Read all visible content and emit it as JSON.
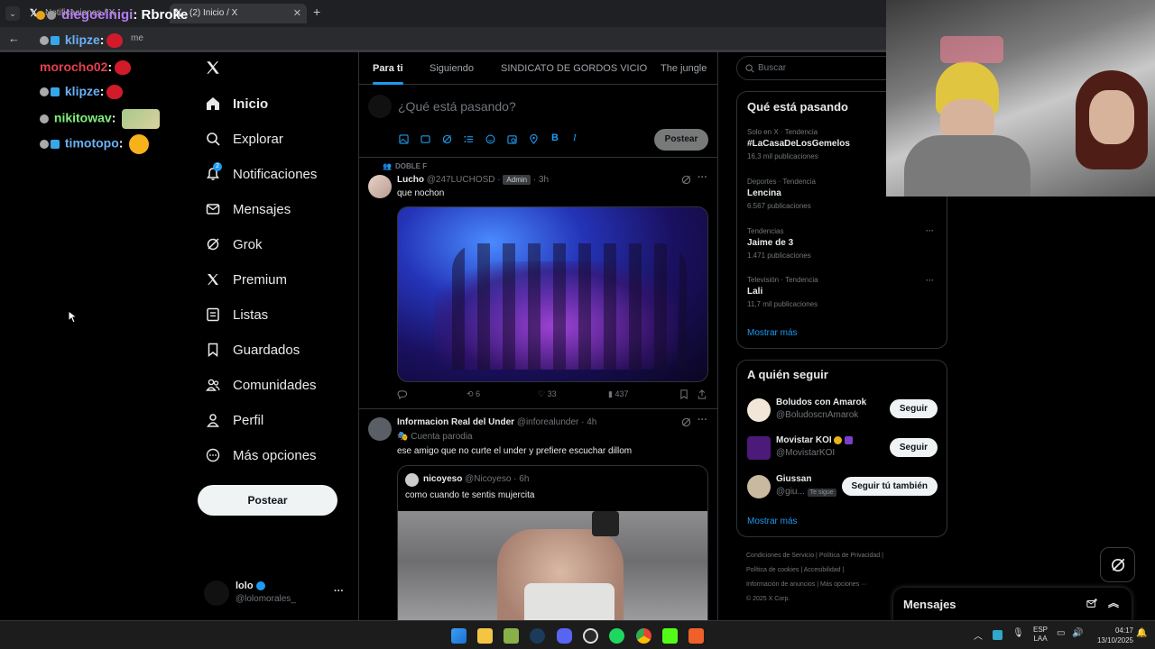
{
  "browser": {
    "tabs": [
      {
        "label": "Notificaciones / X"
      },
      {
        "label": "(2) Inicio / X"
      }
    ],
    "new_tab": "+",
    "address_fragment": "me"
  },
  "stream_chat": [
    {
      "user": "diegoelnigi",
      "text": "Rbroke"
    },
    {
      "user": "klipze",
      "text": ""
    },
    {
      "user": "morocho02",
      "text": ""
    },
    {
      "user": "klipze",
      "text": ""
    },
    {
      "user": "nikitowav",
      "text": ""
    },
    {
      "user": "timotopo",
      "text": ""
    }
  ],
  "nav": {
    "logo": "X",
    "items": [
      {
        "label": "Inicio",
        "icon": "home-icon",
        "active": true
      },
      {
        "label": "Explorar",
        "icon": "search-icon"
      },
      {
        "label": "Notificaciones",
        "icon": "bell-icon",
        "badge": "2"
      },
      {
        "label": "Mensajes",
        "icon": "mail-icon"
      },
      {
        "label": "Grok",
        "icon": "grok-icon"
      },
      {
        "label": "Premium",
        "icon": "x-icon"
      },
      {
        "label": "Listas",
        "icon": "list-icon"
      },
      {
        "label": "Guardados",
        "icon": "bookmark-icon"
      },
      {
        "label": "Comunidades",
        "icon": "people-icon"
      },
      {
        "label": "Perfil",
        "icon": "person-icon"
      },
      {
        "label": "Más opciones",
        "icon": "more-circle-icon"
      }
    ],
    "post_button": "Postear",
    "account": {
      "name": "lolo",
      "handle": "@lolomorales_",
      "more": "···"
    }
  },
  "feed": {
    "tabs": [
      "Para ti",
      "Siguiendo",
      "SINDICATO DE GORDOS VICIO",
      "The jungle"
    ],
    "composer": {
      "placeholder": "¿Qué está pasando?",
      "post_label": "Postear"
    },
    "posts": [
      {
        "context": "DOBLE F",
        "name": "Lucho",
        "handle": "@247LUCHOSD",
        "badge": "Admin",
        "time": "· 3h",
        "text": "que nochon",
        "stats": {
          "replies": "",
          "reposts": "6",
          "likes": "33",
          "views": "437"
        }
      },
      {
        "name": "Informacion Real del Under",
        "handle": "@inforealunder",
        "time": "· 4h",
        "tag": "Cuenta parodia",
        "text": "ese amigo que no curte el under y prefiere escuchar dillom",
        "quote": {
          "name": "nicoyeso",
          "handle": "@Nicoyeso",
          "time": "· 6h",
          "text": "como cuando te sentis mujercita"
        }
      }
    ]
  },
  "sidebar": {
    "search_placeholder": "Buscar",
    "trends_title": "Qué está pasando",
    "trends": [
      {
        "category": "Solo en X · Tendencia",
        "name": "#LaCasaDeLosGemelos",
        "count": "16,3 mil publicaciones"
      },
      {
        "category": "Deportes · Tendencia",
        "name": "Lencina",
        "count": "6.567 publicaciones"
      },
      {
        "category": "Tendencias",
        "name": "Jaime de 3",
        "count": "1.471 publicaciones"
      },
      {
        "category": "Televisión · Tendencia",
        "name": "Lali",
        "count": "11,7 mil publicaciones"
      }
    ],
    "trends_more": "Mostrar más",
    "follow_title": "A quién seguir",
    "follow": [
      {
        "name": "Boludos con Amarok",
        "handle": "@BoludoscnAmarok",
        "button": "Seguir"
      },
      {
        "name": "Movistar KOI",
        "handle": "@MovistarKOI",
        "button": "Seguir"
      },
      {
        "name": "Giussan",
        "handle": "@giu...",
        "tag": "Te sigue",
        "button": "Seguir tú también"
      }
    ],
    "follow_more": "Mostrar más",
    "footer": [
      "Condiciones de Servicio",
      "Política de Privacidad",
      "Política de cookies",
      "Accesibilidad",
      "Información de anuncios",
      "Más opciones ···",
      "© 2025 X Corp."
    ]
  },
  "messages_drawer": {
    "title": "Mensajes"
  },
  "taskbar": {
    "lang": "ESP",
    "lang2": "LAA",
    "time": "04:17",
    "date": "13/10/2025"
  },
  "colors": {
    "accent": "#1d9bf0",
    "background": "#000000",
    "border": "#2f3336",
    "muted": "#71767b"
  }
}
